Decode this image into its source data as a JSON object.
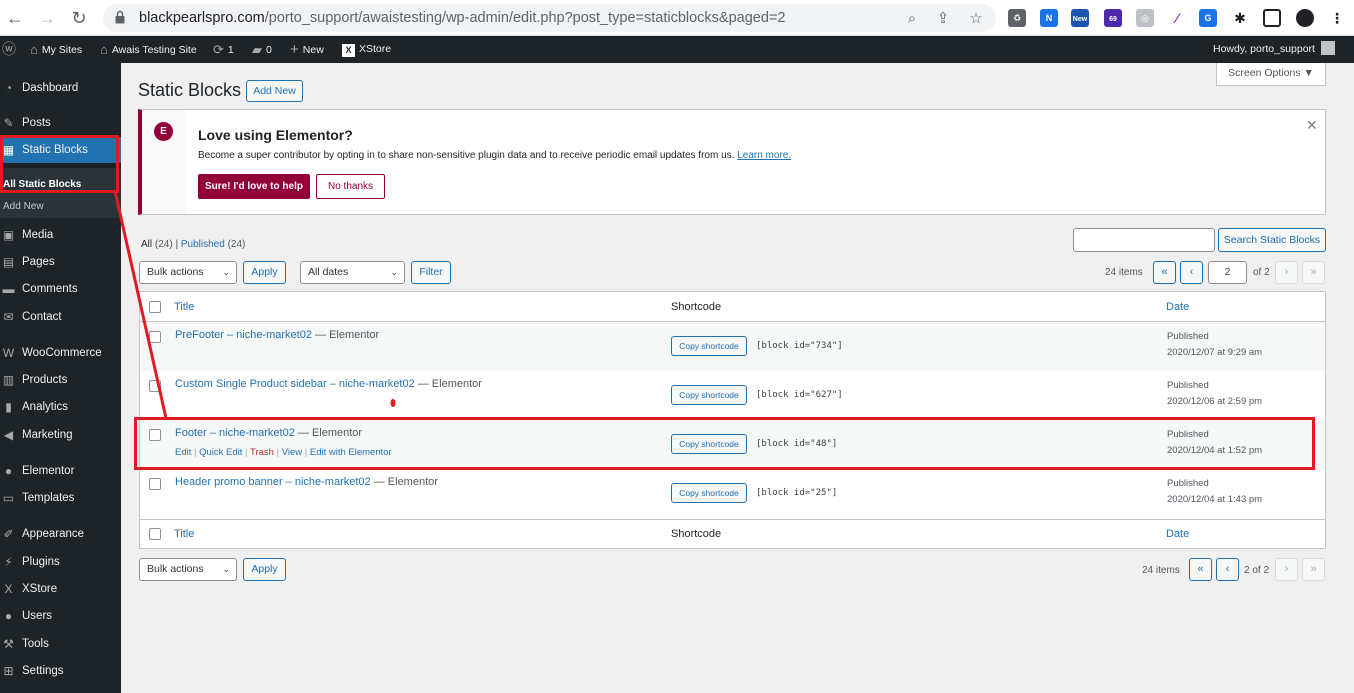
{
  "browser": {
    "url_host": "blackpearlspro.com",
    "url_path": "/porto_support/awaistesting/wp-admin/edit.php?post_type=staticblocks&paged=2",
    "ext_badge_new": "New",
    "ext_badge_69": "69"
  },
  "adminbar": {
    "my_sites": "My Sites",
    "site_name": "Awais Testing Site",
    "updates_count": "1",
    "comments_count": "0",
    "new_label": "New",
    "xstore": "XStore",
    "howdy": "Howdy, porto_support"
  },
  "sidebar": {
    "items": [
      {
        "label": "Dashboard",
        "icon": "dashboard-icon"
      },
      {
        "label": "Posts",
        "icon": "pin-icon"
      },
      {
        "label": "Static Blocks",
        "icon": "grid-icon"
      },
      {
        "label": "Media",
        "icon": "media-icon"
      },
      {
        "label": "Pages",
        "icon": "page-icon"
      },
      {
        "label": "Comments",
        "icon": "comment-icon"
      },
      {
        "label": "Contact",
        "icon": "mail-icon"
      },
      {
        "label": "WooCommerce",
        "icon": "woo-icon"
      },
      {
        "label": "Products",
        "icon": "box-icon"
      },
      {
        "label": "Analytics",
        "icon": "chart-icon"
      },
      {
        "label": "Marketing",
        "icon": "megaphone-icon"
      },
      {
        "label": "Elementor",
        "icon": "elementor-icon"
      },
      {
        "label": "Templates",
        "icon": "folder-icon"
      },
      {
        "label": "Appearance",
        "icon": "brush-icon"
      },
      {
        "label": "Plugins",
        "icon": "plug-icon"
      },
      {
        "label": "XStore",
        "icon": "xstore-icon"
      },
      {
        "label": "Users",
        "icon": "user-icon"
      },
      {
        "label": "Tools",
        "icon": "wrench-icon"
      },
      {
        "label": "Settings",
        "icon": "settings-icon"
      }
    ],
    "submenu": [
      "All Static Blocks",
      "Add New"
    ]
  },
  "screen_options": "Screen Options ▼",
  "page": {
    "title": "Static Blocks",
    "add_new": "Add New"
  },
  "notice": {
    "title": "Love using Elementor?",
    "text": "Become a super contributor by opting in to share non-sensitive plugin data and to receive periodic email updates from us.",
    "learn_more": "Learn more.",
    "yes_btn": "Sure! I'd love to help",
    "no_btn": "No thanks",
    "accent": "#92003b"
  },
  "views": {
    "all": "All",
    "all_count": "(24)",
    "sep": "|",
    "published": "Published",
    "published_count": "(24)"
  },
  "search_btn": "Search Static Blocks",
  "filters": {
    "bulk_actions": "Bulk actions",
    "apply": "Apply",
    "all_dates": "All dates",
    "filter": "Filter"
  },
  "pagination": {
    "items": "24 items",
    "first": "«",
    "prev": "‹",
    "current_page": "2",
    "of": "of 2",
    "next": "›",
    "last": "»",
    "bottom_page": "2 of 2"
  },
  "table": {
    "col_title": "Title",
    "col_shortcode": "Shortcode",
    "col_date": "Date",
    "copy_label": "Copy shortcode",
    "rows": [
      {
        "title": "PreFooter – niche-market02",
        "state": " — Elementor",
        "shortcode": "[block id=\"734\"]",
        "status": "Published",
        "date": "2020/12/07 at 9:29 am"
      },
      {
        "title": "Custom Single Product sidebar – niche-market02",
        "state": " — Elementor",
        "shortcode": "[block id=\"627\"]",
        "status": "Published",
        "date": "2020/12/06 at 2:59 pm"
      },
      {
        "title": "Footer – niche-market02",
        "state": " — Elementor",
        "shortcode": "[block id=\"48\"]",
        "status": "Published",
        "date": "2020/12/04 at 1:52 pm",
        "actions": {
          "edit": "Edit",
          "quick_edit": "Quick Edit",
          "trash": "Trash",
          "view": "View",
          "edit_elementor": "Edit with Elementor"
        }
      },
      {
        "title": "Header promo banner – niche-market02",
        "state": " — Elementor",
        "shortcode": "[block id=\"25\"]",
        "status": "Published",
        "date": "2020/12/04 at 1:43 pm"
      }
    ]
  },
  "colors": {
    "link": "#2271b1",
    "admin_dark": "#1d2327",
    "highlight": "#e01b24"
  }
}
